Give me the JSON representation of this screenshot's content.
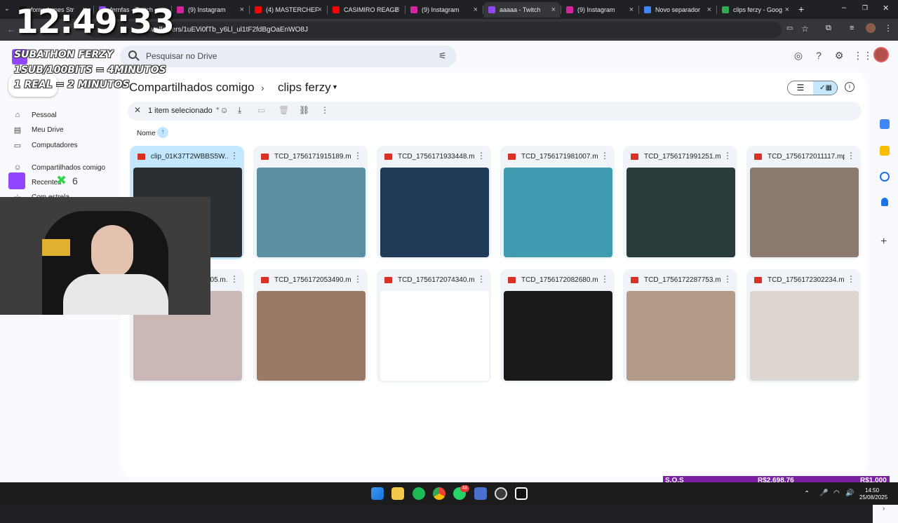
{
  "browser": {
    "tabs": [
      {
        "label": "fornadames Str",
        "favicon": "tiktok",
        "active": false
      },
      {
        "label": "fernfas - Twitch",
        "favicon": "twitch",
        "active": false
      },
      {
        "label": "(9) Instagram",
        "favicon": "instagram",
        "active": false
      },
      {
        "label": "(4) MASTERCHEF",
        "favicon": "youtube",
        "active": false
      },
      {
        "label": "CASIMIRO REAGE",
        "favicon": "youtube",
        "active": false
      },
      {
        "label": "(9) Instagram",
        "favicon": "instagram",
        "active": false
      },
      {
        "label": "aaaaa - Twitch",
        "favicon": "twitch",
        "active": true
      },
      {
        "label": "(9) Instagram",
        "favicon": "instagram",
        "active": false
      },
      {
        "label": "Novo separador",
        "favicon": "chrome",
        "active": false
      },
      {
        "label": "clips ferzy - Goog",
        "favicon": "drive",
        "active": false
      }
    ],
    "url": "drive/folders/1uEVi0fTb_y6Ll_ul1tF2fdBgOaEnWO8J"
  },
  "drive": {
    "search_placeholder": "Pesquisar no Drive",
    "breadcrumb_parent": "Compartilhados comigo",
    "breadcrumb_current": "clips ferzy",
    "selection_text": "1 item selecionado",
    "sort_label": "Nome",
    "nav": [
      {
        "label": "Pessoal",
        "icon": "home-icon"
      },
      {
        "label": "Meu Drive",
        "icon": "drive-icon"
      },
      {
        "label": "Computadores",
        "icon": "computer-icon"
      },
      {
        "label": "Compartilhados comigo",
        "icon": "shared-icon"
      },
      {
        "label": "Recentes",
        "icon": "clock-icon"
      },
      {
        "label": "Com estrela",
        "icon": "star-icon"
      }
    ],
    "files": [
      {
        "name": "clip_01K37T2WBBS5W...",
        "selected": true,
        "thumb": "#2b2f33"
      },
      {
        "name": "TCD_1756171915189.mp4",
        "selected": false,
        "thumb": "#5d8fa2"
      },
      {
        "name": "TCD_1756171933448.mp4",
        "selected": false,
        "thumb": "#1f3b57"
      },
      {
        "name": "TCD_1756171981007.mp4",
        "selected": false,
        "thumb": "#3f9bb0"
      },
      {
        "name": "TCD_1756171991251.mp4",
        "selected": false,
        "thumb": "#2a3c3a"
      },
      {
        "name": "TCD_1756172011117.mp4",
        "selected": false,
        "thumb": "#8a7a70"
      },
      {
        "name": "TCD_175617200...05.m...",
        "selected": false,
        "thumb": "#c9b8b6"
      },
      {
        "name": "TCD_1756172053490.m...",
        "selected": false,
        "thumb": "#9a7a66"
      },
      {
        "name": "TCD_1756172074340.m...",
        "selected": false,
        "thumb": "#ffffff"
      },
      {
        "name": "TCD_1756172082680.m...",
        "selected": false,
        "thumb": "#1a1a1a"
      },
      {
        "name": "TCD_1756172287753.mp4",
        "selected": false,
        "thumb": "#b39a86"
      },
      {
        "name": "TCD_1756172302234.m...",
        "selected": false,
        "thumb": "#ddd6d0"
      }
    ]
  },
  "overlay": {
    "clock": "12:49:33",
    "subathon_title": "SUBATHON FERZY",
    "rule_1": "1SUB/100BITS = 4MINUTOS",
    "rule_2": "1 REAL = 2 MINUTOS",
    "twitch_count": "6"
  },
  "sos_bar": {
    "label": "S.O.S",
    "current": "R$2,698.76",
    "goal": "R$1,000"
  },
  "taskbar": {
    "time": "14:50",
    "date": "25/08/2025",
    "whatsapp_badge": "48"
  },
  "colors": {
    "drive_bg": "#f8fafd",
    "selected_card": "#c2e7ff",
    "sos_purple": "#7a1fa2",
    "video_red": "#d93025"
  }
}
